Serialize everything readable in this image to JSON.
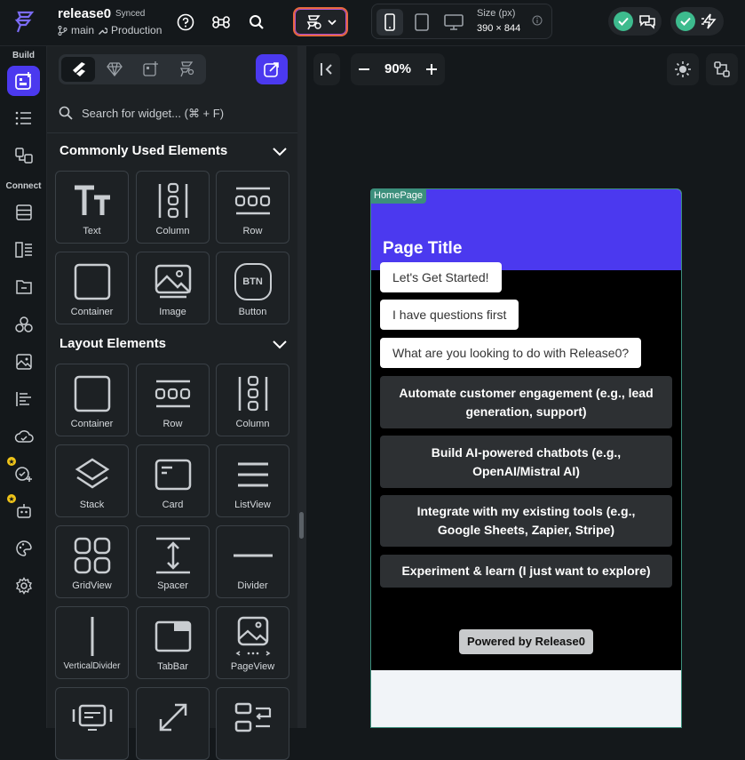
{
  "project": {
    "name": "release0",
    "sync_status": "Synced",
    "branch": "main",
    "environment": "Production"
  },
  "device": {
    "size_label": "Size (px)",
    "size_value": "390 × 844"
  },
  "sidebar": {
    "build_label": "Build",
    "connect_label": "Connect"
  },
  "panel": {
    "search_placeholder": "Search for widget... (⌘ + F)",
    "sections": [
      {
        "title": "Commonly Used Elements",
        "items": [
          "Text",
          "Column",
          "Row",
          "Container",
          "Image",
          "Button"
        ]
      },
      {
        "title": "Layout Elements",
        "items": [
          "Container",
          "Row",
          "Column",
          "Stack",
          "Card",
          "ListView",
          "GridView",
          "Spacer",
          "Divider",
          "VerticalDivider",
          "TabBar",
          "PageView"
        ]
      }
    ],
    "button_icon_text": "BTN"
  },
  "canvas": {
    "zoom": "90%"
  },
  "phone": {
    "page_tag": "HomePage",
    "title": "Page Title",
    "bubbles": [
      "Let's Get Started!",
      "I have questions first",
      "What are you looking to do with Release0?"
    ],
    "options": [
      "Automate customer engagement (e.g., lead generation, support)",
      "Build AI-powered chatbots (e.g., OpenAI/Mistral AI)",
      "Integrate with my existing tools (e.g., Google Sheets, Zapier, Stripe)",
      "Experiment & learn (I just want to explore)"
    ],
    "powered_by": "Powered by Release0"
  },
  "colors": {
    "accent": "#4b39ef",
    "success": "#3dbb8e",
    "page_tag": "#3c8f7c",
    "background": "#14181b"
  }
}
